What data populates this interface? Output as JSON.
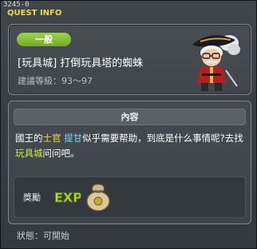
{
  "window": {
    "quest_id": "3245-0",
    "title": "QUEST INFO"
  },
  "header": {
    "badge": "一般",
    "quest_name": "[玩具城] 打倒玩具塔的蜘蛛",
    "recommend_level": "建議等級：93～97",
    "npc_icon": "npc-pirate-king-icon"
  },
  "content": {
    "section_title": "內容",
    "description_parts": [
      "國王的",
      "士官",
      "提甘",
      "似乎需要帮助，到底是什么事情呢?去找 ",
      "玩具城",
      "问问吧。"
    ]
  },
  "reward": {
    "label": "獎勵",
    "items": [
      "exp-icon",
      "meso-bag-icon"
    ],
    "exp_text": "EXP"
  },
  "footer": {
    "status": "狀態：可開始"
  },
  "colors": {
    "title": "#f2d64a",
    "badge": "#8cc63f",
    "highlight_yellow": "#f4d84c",
    "highlight_cyan": "#7fd8f0",
    "highlight_green": "#c9f03c"
  }
}
